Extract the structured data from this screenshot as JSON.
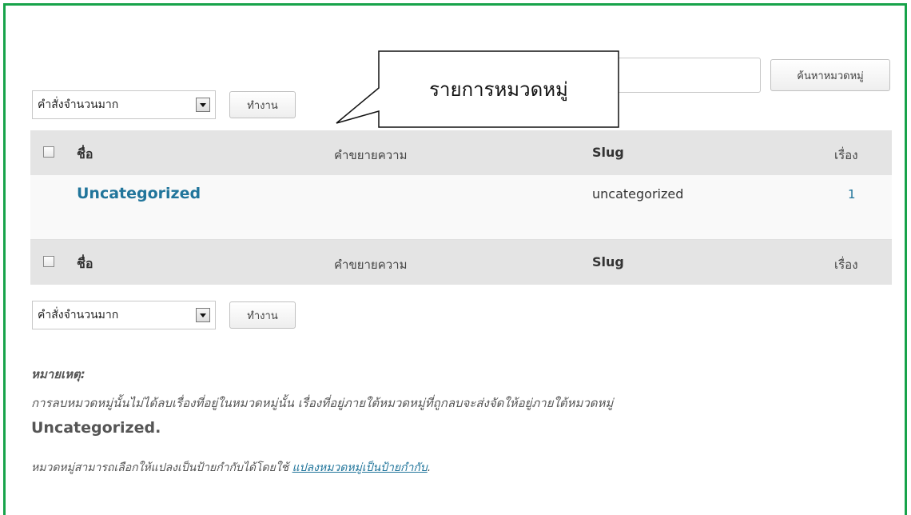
{
  "search": {
    "value": "",
    "button_label": "ค้นหาหมวดหมู่"
  },
  "callout": {
    "text": "รายการหมวดหมู่"
  },
  "bulk_top": {
    "selected": "คำสั่งจำนวนมาก",
    "apply_label": "ทำงาน"
  },
  "bulk_bottom": {
    "selected": "คำสั่งจำนวนมาก",
    "apply_label": "ทำงาน"
  },
  "table": {
    "columns": {
      "name": "ชื่อ",
      "description": "คำขยายความ",
      "slug": "Slug",
      "posts": "เรื่อง"
    },
    "rows": [
      {
        "name": "Uncategorized",
        "description": "",
        "slug": "uncategorized",
        "posts": "1"
      }
    ]
  },
  "note": {
    "title": "หมายเหตุ:",
    "line1": "การลบหมวดหมู่นั้นไม่ได้ลบเรื่องที่อยู่ในหมวดหมู่นั้น เรื่องที่อยู่ภายใต้หมวดหมู่ที่ถูกลบจะส่งจัดให้อยู่ภายใต้หมวดหมู่",
    "category": "Uncategorized.",
    "line2_prefix": "หมวดหมู่สามารถเลือกให้แปลงเป็นป้ายกำกับได้โดยใช้ ",
    "line2_link": "แปลงหมวดหมู่เป็นป้ายกำกับ",
    "line2_suffix": "."
  }
}
